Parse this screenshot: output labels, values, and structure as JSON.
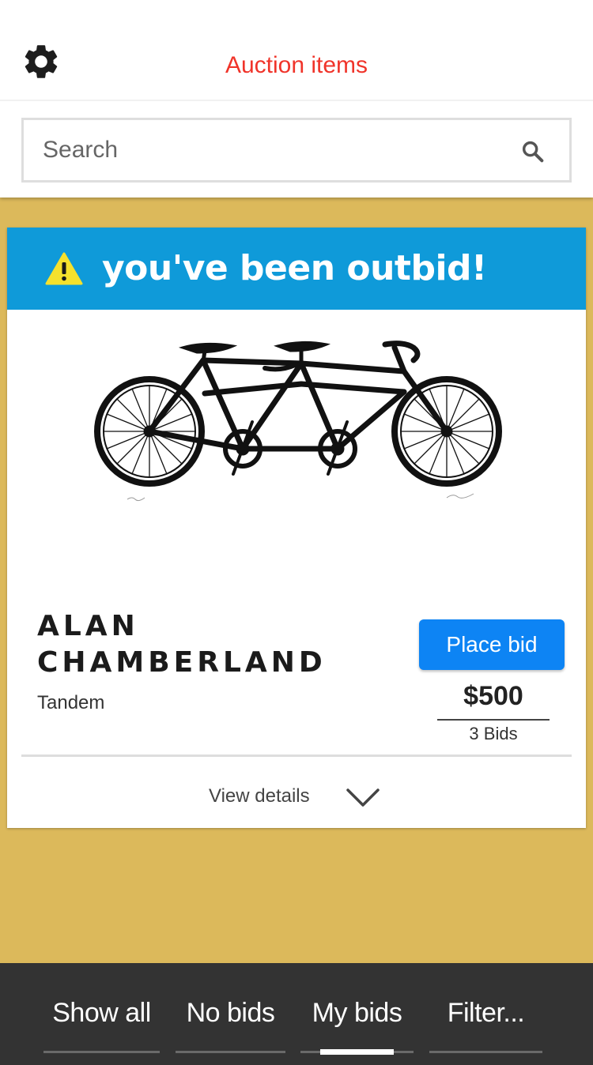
{
  "header": {
    "title": "Auction items",
    "settings_icon": "gear-icon"
  },
  "search": {
    "placeholder": "Search",
    "value": "",
    "icon": "search-icon"
  },
  "item": {
    "alert": "you've been outbid!",
    "alert_icon": "warning-icon",
    "artist_line1": "ALAN",
    "artist_line2": "CHAMBERLAND",
    "title": "Tandem",
    "image": "tandem-bicycle-print",
    "place_bid_label": "Place bid",
    "price": "$500",
    "bids": "3 Bids",
    "view_details_label": "View details"
  },
  "tabs": [
    {
      "label": "Show all",
      "active": false
    },
    {
      "label": "No bids",
      "active": false
    },
    {
      "label": "My bids",
      "active": true
    },
    {
      "label": "Filter...",
      "active": false
    }
  ],
  "colors": {
    "title_red": "#f0342a",
    "alert_blue": "#0f9ad9",
    "bid_button_blue": "#0d84f4",
    "background_gold": "#dcb95b",
    "tabbar_dark": "#333333"
  }
}
